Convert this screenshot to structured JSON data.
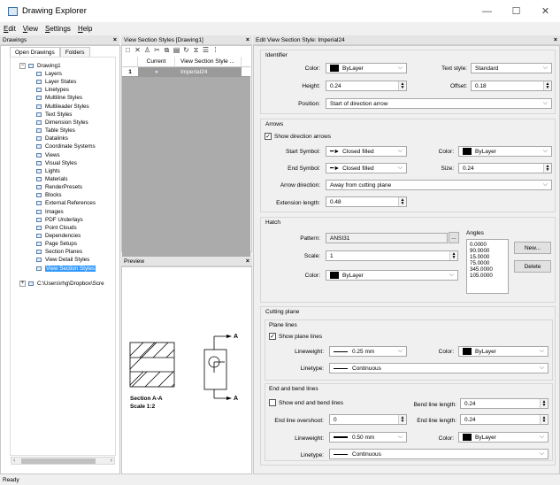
{
  "window": {
    "title": "Drawing Explorer",
    "minimize": "—",
    "maximize": "☐",
    "close": "✕"
  },
  "menu": [
    {
      "label": "Edit",
      "key": "E"
    },
    {
      "label": "View",
      "key": "V"
    },
    {
      "label": "Settings",
      "key": "S"
    },
    {
      "label": "Help",
      "key": "H"
    }
  ],
  "left": {
    "title": "Drawings",
    "close": "×",
    "tabs": [
      "Open Drawings",
      "Folders"
    ],
    "tree": {
      "root": "Drawing1",
      "items": [
        "Layers",
        "Layer States",
        "Linetypes",
        "Multiline Styles",
        "Multileader Styles",
        "Text Styles",
        "Dimension Styles",
        "Table Styles",
        "Datalinks",
        "Coordinate Systems",
        "Views",
        "Visual Styles",
        "Lights",
        "Materials",
        "RenderPresets",
        "Blocks",
        "External References",
        "Images",
        "PDF Underlays",
        "Point Clouds",
        "Dependencies",
        "Page Setups",
        "Section Planes",
        "View Detail Styles",
        "View Section Styles"
      ],
      "selected": "View Section Styles",
      "other": "C:\\Users\\rhg\\Dropbox\\Scre"
    }
  },
  "middle": {
    "title": "View Section Styles [Drawing1]",
    "close": "×",
    "columns": [
      "Current",
      "View Section Style ..."
    ],
    "rows": [
      {
        "num": "1",
        "current": "●",
        "name": "Imperial24"
      }
    ],
    "preview": {
      "title": "Preview",
      "close": "×",
      "labelA": "A",
      "sectionText": "Section A-A",
      "scaleText": "Scale 1:2"
    }
  },
  "right": {
    "title": "Edit View Section Style: Imperial24",
    "close": "×",
    "identifier": {
      "heading": "Identifier",
      "color_label": "Color:",
      "color": "ByLayer",
      "text_style_label": "Text style:",
      "text_style": "Standard",
      "height_label": "Height:",
      "height": "0.24",
      "offset_label": "Offset:",
      "offset": "0.18",
      "position_label": "Position:",
      "position": "Start of direction arrow"
    },
    "arrows": {
      "heading": "Arrows",
      "show": "Show direction arrows",
      "start_label": "Start Symbol:",
      "start": "Closed filled",
      "color_label": "Color:",
      "color": "ByLayer",
      "end_label": "End Symbol:",
      "end": "Closed filled",
      "size_label": "Size:",
      "size": "0.24",
      "direction_label": "Arrow direction:",
      "direction": "Away from cutting plane",
      "ext_label": "Extension length:",
      "ext": "0.48"
    },
    "hatch": {
      "heading": "Hatch",
      "pattern_label": "Pattern:",
      "pattern": "ANSI31",
      "browse": "...",
      "scale_label": "Scale:",
      "scale": "1",
      "color_label": "Color:",
      "color": "ByLayer",
      "angles_label": "Angles",
      "angles": [
        "0.0000",
        "90.0000",
        "15.0000",
        "75.0000",
        "345.0000",
        "105.0000"
      ],
      "new": "New...",
      "delete": "Delete"
    },
    "cutting": {
      "heading": "Cutting plane",
      "plane_lines": "Plane lines",
      "show_plane": "Show plane lines",
      "lw_label": "Lineweight:",
      "lw": "0.25 mm",
      "color_label": "Color:",
      "color": "ByLayer",
      "lt_label": "Linetype:",
      "lt": "Continuous",
      "eb_heading": "End and bend lines",
      "show_eb": "Show end and bend lines",
      "bend_label": "Bend line length:",
      "bend": "0.24",
      "overshoot_label": "End line overshoot:",
      "overshoot": "0",
      "endlen_label": "End line length:",
      "endlen": "0.24",
      "lw2": "0.50 mm",
      "color2": "ByLayer",
      "lt2": "Continuous"
    }
  },
  "status": "Ready"
}
